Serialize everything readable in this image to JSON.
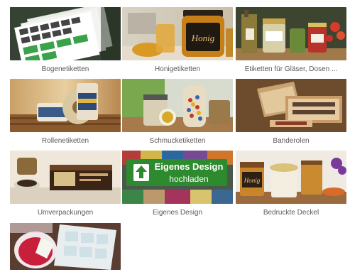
{
  "colors": {
    "label_text": "#5a5a5a",
    "cta_green": "#2e8a2e"
  },
  "tiles": [
    {
      "label": "Bogenetiketten",
      "image": "sticker-sheets-image"
    },
    {
      "label": "Honigetiketten",
      "image": "honey-jar-image"
    },
    {
      "label": "Etiketten für Gläser, Dosen ...",
      "image": "jars-and-bottles-image"
    },
    {
      "label": "Rollenetiketten",
      "image": "label-rolls-image"
    },
    {
      "label": "Schmucketiketten",
      "image": "decorated-jars-image"
    },
    {
      "label": "Banderolen",
      "image": "banderole-box-image"
    },
    {
      "label": "Umverpackungen",
      "image": "outer-packaging-image"
    },
    {
      "label": "Eigenes Design",
      "image": "upload-design-image"
    },
    {
      "label": "Bedruckte Deckel",
      "image": "printed-lids-image"
    },
    {
      "label": "",
      "image": "tea-labels-image"
    }
  ],
  "upload_cta": {
    "line1": "Eigenes Design",
    "line2": "hochladen",
    "icon": "upload-arrow-icon"
  },
  "jar_text": {
    "honig": "Honig",
    "honig_small": "Honig"
  }
}
